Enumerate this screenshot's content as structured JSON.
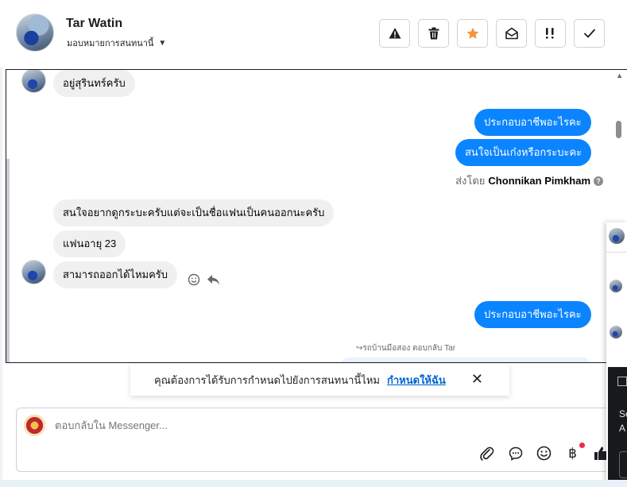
{
  "header": {
    "contact_name": "Tar Watin",
    "assign_label": "มอบหมายการสนทนานี้",
    "toolbar": [
      {
        "name": "report-button",
        "icon": "warning-icon"
      },
      {
        "name": "delete-button",
        "icon": "trash-icon"
      },
      {
        "name": "star-button",
        "icon": "star-icon"
      },
      {
        "name": "mark-unread-button",
        "icon": "envelope-open-icon"
      },
      {
        "name": "follow-up-button",
        "icon": "exclamation-icon"
      },
      {
        "name": "mark-done-button",
        "icon": "check-icon"
      }
    ]
  },
  "messages": {
    "m1": "อยู่สุรินทร์ครับ",
    "m2": "ประกอบอาชีพอะไรคะ",
    "m3": "สนใจเป็นเก๋งหรือกระบะคะ",
    "sent_by_prefix": "ส่งโดย",
    "sent_by_name": "Chonnikan Pimkham",
    "m4": "สนใจอยากดูกระบะครับแต่จะเป็นชื่อแฟนเป็นคนออกนะครับ",
    "m5": "แฟนอายุ 23",
    "m6": "สามารถออกได้ไหมครับ",
    "m7": "ประกอบอาชีพอะไรคะ",
    "reply_meta": "รถบ้านมือสอง ตอบกลับ Tar"
  },
  "assign_bar": {
    "text": "คุณต้องการได้รับการกำหนดไปยังการสนทนานี้ไหม",
    "link": "กำหนดให้ฉัน"
  },
  "composer": {
    "placeholder": "ตอบกลับใน Messenger..."
  },
  "side": {
    "s1": "Se",
    "s2": "A"
  },
  "colors": {
    "outgoing_bubble": "#0b84ff",
    "incoming_bubble": "#f0f0f0",
    "star": "#f7923a",
    "link": "#0064d1"
  }
}
